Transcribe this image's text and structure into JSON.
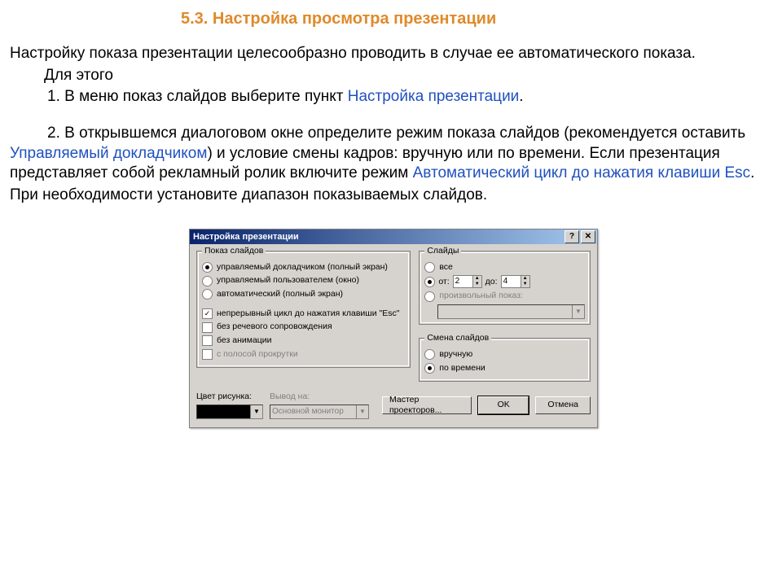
{
  "title": "5.3.  Настройка просмотра презентации",
  "body": {
    "p1": "Настройку показа презентации целесообразно проводить в случае ее автоматического показа.",
    "p2": "Для этого",
    "step1_a": "1.  В меню показ слайдов выберите пункт ",
    "step1_b": "Настройка презентации",
    "step1_c": ".",
    "step2_a": "2.  В открывшемся диалоговом окне определите режим показа слайдов (рекомендуется оставить ",
    "step2_b": "Управляемый докладчиком",
    "step2_c": ") и условие смены кадров: вручную или по времени. Если презентация представляет собой рекламный ролик включите режим ",
    "step2_d": "Автоматический цикл до нажатия клавиши Esc",
    "step2_e": ".",
    "p3": "При необходимости установите диапазон  показываемых слайдов."
  },
  "dialog": {
    "title": "Настройка презентации",
    "help_btn": "?",
    "close_btn": "✕",
    "group_show": "Показ слайдов",
    "opts_show": {
      "r1": "управляемый докладчиком (полный экран)",
      "r2": "управляемый пользователем (окно)",
      "r3": "автоматический (полный экран)",
      "c1": "непрерывный цикл до нажатия клавиши \"Esc\"",
      "c2": "без речевого сопровождения",
      "c3": "без анимации",
      "c4": "с полосой прокрутки"
    },
    "group_slides": "Слайды",
    "slides": {
      "all": "все",
      "from_lbl": "от:",
      "from_val": "2",
      "to_lbl": "до:",
      "to_val": "4",
      "custom": "произвольный показ:"
    },
    "group_advance": "Смена слайдов",
    "advance": {
      "manual": "вручную",
      "timed": "по времени"
    },
    "bottom": {
      "pen_color": "Цвет рисунка:",
      "output": "Вывод на:",
      "output_val": "Основной монитор",
      "projector_btn": "Мастер проекторов...",
      "ok": "OK",
      "cancel": "Отмена"
    }
  }
}
